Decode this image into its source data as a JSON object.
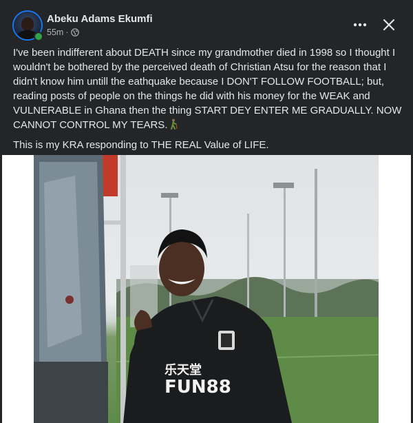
{
  "post": {
    "author": "Abeku Adams Ekumfi",
    "time": "55m",
    "separator": "·",
    "privacy_icon": "globe-icon",
    "more_icon": "more-horizontal-icon",
    "close_icon": "close-icon",
    "paragraph1": "I've been indifferent about DEATH since my grandmother died in 1998 so I thought I wouldn't be bothered by the perceived death of Christian Atsu for the reason that I didn't know him untill the eathquake because I DON'T FOLLOW FOOTBALL; but, reading posts of people on the things he did with his money for the WEAK and VULNERABLE in Ghana then the thing START DEY ENTER ME  GRADUALLY. NOW CANNOT CONTROL MY TEARS.",
    "paragraph1_emoji": "person-walking-with-cane-icon",
    "paragraph2": "This is my KRA responding to THE REAL Value of LIFE.",
    "photo": {
      "subject": "footballer-photo",
      "shirt_text_top": "乐天堂",
      "shirt_text_bottom": "FUN88"
    }
  },
  "colors": {
    "background": "#242526",
    "text_primary": "#e4e6eb",
    "text_secondary": "#b0b3b8",
    "online": "#31a24c",
    "avatar_ring": "#1877f2"
  }
}
